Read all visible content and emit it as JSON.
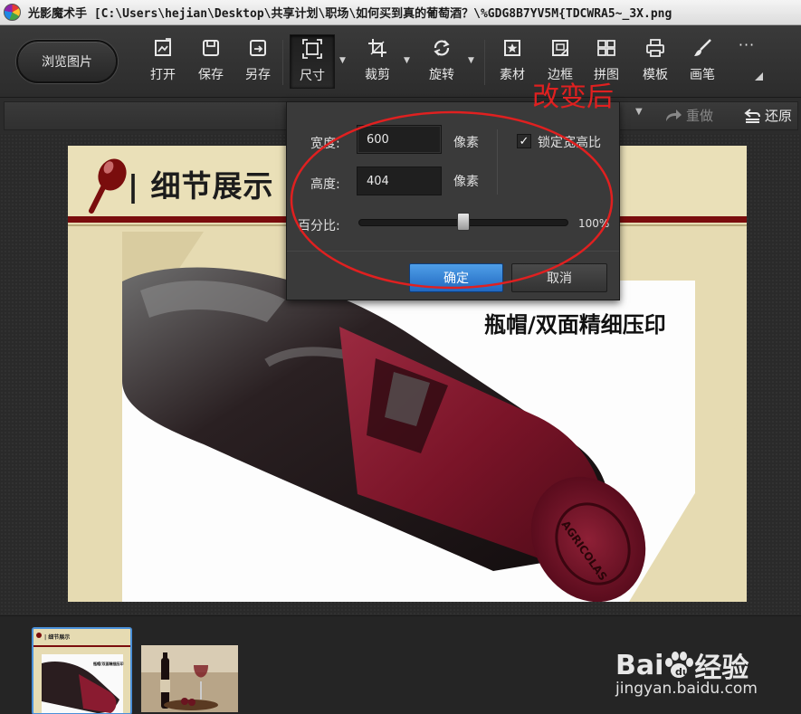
{
  "window": {
    "title": "光影魔术手  [C:\\Users\\hejian\\Desktop\\共享计划\\职场\\如何买到真的葡萄酒？\\%GDG8B7YV5M{TDCWRA5~_3X.png"
  },
  "toolbar": {
    "browse_label": "浏览图片",
    "tools": [
      {
        "id": "open",
        "label": "打开",
        "icon": "open-image-icon"
      },
      {
        "id": "save",
        "label": "保存",
        "icon": "save-icon"
      },
      {
        "id": "save_as",
        "label": "另存",
        "icon": "save-as-icon"
      },
      {
        "id": "size",
        "label": "尺寸",
        "icon": "resize-icon",
        "active": true
      },
      {
        "id": "crop",
        "label": "裁剪",
        "icon": "crop-icon"
      },
      {
        "id": "rotate",
        "label": "旋转",
        "icon": "rotate-icon"
      },
      {
        "id": "material",
        "label": "素材",
        "icon": "sticker-icon"
      },
      {
        "id": "border",
        "label": "边框",
        "icon": "frame-icon"
      },
      {
        "id": "collage",
        "label": "拼图",
        "icon": "collage-icon"
      },
      {
        "id": "template",
        "label": "模板",
        "icon": "print-template-icon"
      },
      {
        "id": "brush",
        "label": "画笔",
        "icon": "brush-icon"
      },
      {
        "id": "more",
        "label": "···",
        "icon": "more-icon"
      }
    ]
  },
  "secondbar": {
    "redo_label": "重做",
    "restore_label": "还原"
  },
  "size_dialog": {
    "width_label": "宽度:",
    "width_value": "600",
    "height_label": "高度:",
    "height_value": "404",
    "unit_label": "像素",
    "lock_ratio_label": "锁定宽高比",
    "lock_ratio_checked": true,
    "percent_label": "百分比:",
    "percent_value": "100%",
    "slider_fraction": 0.5,
    "ok_label": "确定",
    "cancel_label": "取消"
  },
  "annotation": {
    "text": "改变后",
    "color": "#e02020"
  },
  "photo": {
    "header_text": "| 细节展示",
    "caption": "瓶帽/双面精细压印",
    "cap_text": "AGRICOLAS",
    "accent_color": "#7a0d0d"
  },
  "filmstrip": {
    "thumb1_header": "| 细节展示",
    "thumb1_caption": "瓶帽/双面精细压印"
  },
  "watermark": {
    "brand": "Bai",
    "brand_tail": "经验",
    "url": "jingyan.baidu.com"
  }
}
